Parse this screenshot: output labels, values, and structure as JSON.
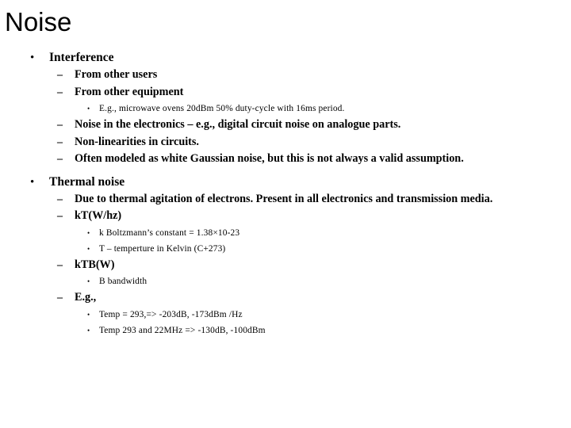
{
  "slide": {
    "title": "Noise",
    "background_color": "#ffffff",
    "text_color": "#000000",
    "bullet_glyph_level1": "•",
    "bullet_glyph_level2": "–",
    "bullet_glyph_level3": "•"
  },
  "outline": [
    {
      "level": 1,
      "text": "Interference"
    },
    {
      "level": 2,
      "text": "From other users"
    },
    {
      "level": 2,
      "text": "From other equipment"
    },
    {
      "level": 3,
      "text": "E.g., microwave ovens 20dBm 50% duty-cycle with 16ms period."
    },
    {
      "level": 2,
      "text": "Noise in the electronics – e.g., digital circuit noise on analogue parts."
    },
    {
      "level": 2,
      "text": "Non-linearities in circuits."
    },
    {
      "level": 2,
      "text": "Often modeled as white Gaussian noise, but this is not always a valid assumption."
    },
    {
      "level": 1,
      "text": "Thermal noise"
    },
    {
      "level": 2,
      "text": "Due to thermal agitation of electrons. Present in all electronics and transmission media."
    },
    {
      "level": 2,
      "text": "kT(W/hz)"
    },
    {
      "level": 3,
      "text": "k Boltzmann’s constant = 1.38×10-23"
    },
    {
      "level": 3,
      "text": "T – temperture in Kelvin (C+273)"
    },
    {
      "level": 2,
      "text": "kTB(W)"
    },
    {
      "level": 3,
      "text": "B bandwidth"
    },
    {
      "level": 2,
      "text": "E.g.,"
    },
    {
      "level": 3,
      "text": "Temp = 293,=> -203dB, -173dBm /Hz"
    },
    {
      "level": 3,
      "text": "Temp 293 and 22MHz => -130dB, -100dBm"
    }
  ]
}
